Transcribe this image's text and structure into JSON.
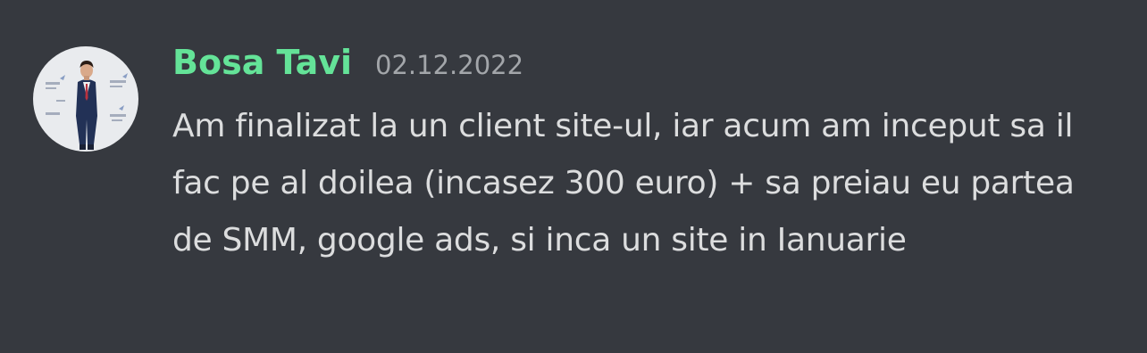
{
  "message": {
    "author": {
      "name": "Bosa Tavi",
      "color": "#64e398",
      "avatar_icon": "user-avatar-photo"
    },
    "timestamp": "02.12.2022",
    "text": "Am finalizat la un client site-ul, iar acum am inceput sa il fac pe al doilea (incasez 300 euro) + sa preiau eu partea de SMM, google ads, si inca un site in Ianuarie"
  },
  "colors": {
    "background": "#36393f",
    "message_text": "#dcddde",
    "timestamp": "#a3a6aa"
  }
}
